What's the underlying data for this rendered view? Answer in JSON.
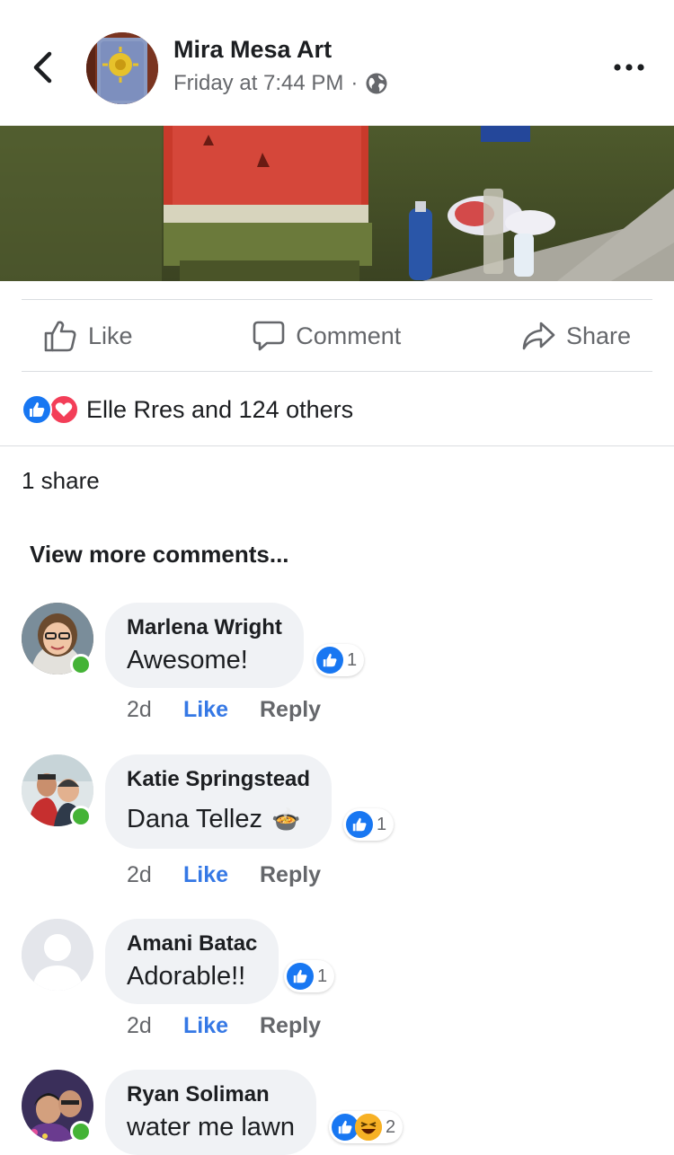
{
  "post": {
    "page_name": "Mira Mesa Art",
    "time": "Friday at 7:44 PM",
    "separator": "·",
    "privacy_icon": "globe-icon"
  },
  "actions": {
    "like": "Like",
    "comment": "Comment",
    "share": "Share"
  },
  "reactions": {
    "summary": "Elle Rres and 124 others",
    "icons": [
      "like-reaction-icon",
      "love-reaction-icon"
    ]
  },
  "shares": "1 share",
  "view_more": "View more comments...",
  "comments": [
    {
      "author": "Marlena Wright",
      "text": "Awesome!",
      "reaction_count": "1",
      "time": "2d",
      "like": "Like",
      "reply": "Reply",
      "online": true
    },
    {
      "author": "Katie Springstead",
      "text": "Dana Tellez",
      "emoji": "🍲",
      "reaction_count": "1",
      "time": "2d",
      "like": "Like",
      "reply": "Reply",
      "online": true
    },
    {
      "author": "Amani Batac",
      "text": "Adorable!!",
      "reaction_count": "1",
      "time": "2d",
      "like": "Like",
      "reply": "Reply",
      "online": false
    },
    {
      "author": "Ryan Soliman",
      "text": "water me lawn",
      "reaction_count": "2",
      "online": true
    }
  ],
  "colors": {
    "link_blue": "#3578e5",
    "like_blue": "#1877f2",
    "love_red": "#f33e58",
    "online_green": "#44b336",
    "bubble_gray": "#f0f2f5"
  }
}
